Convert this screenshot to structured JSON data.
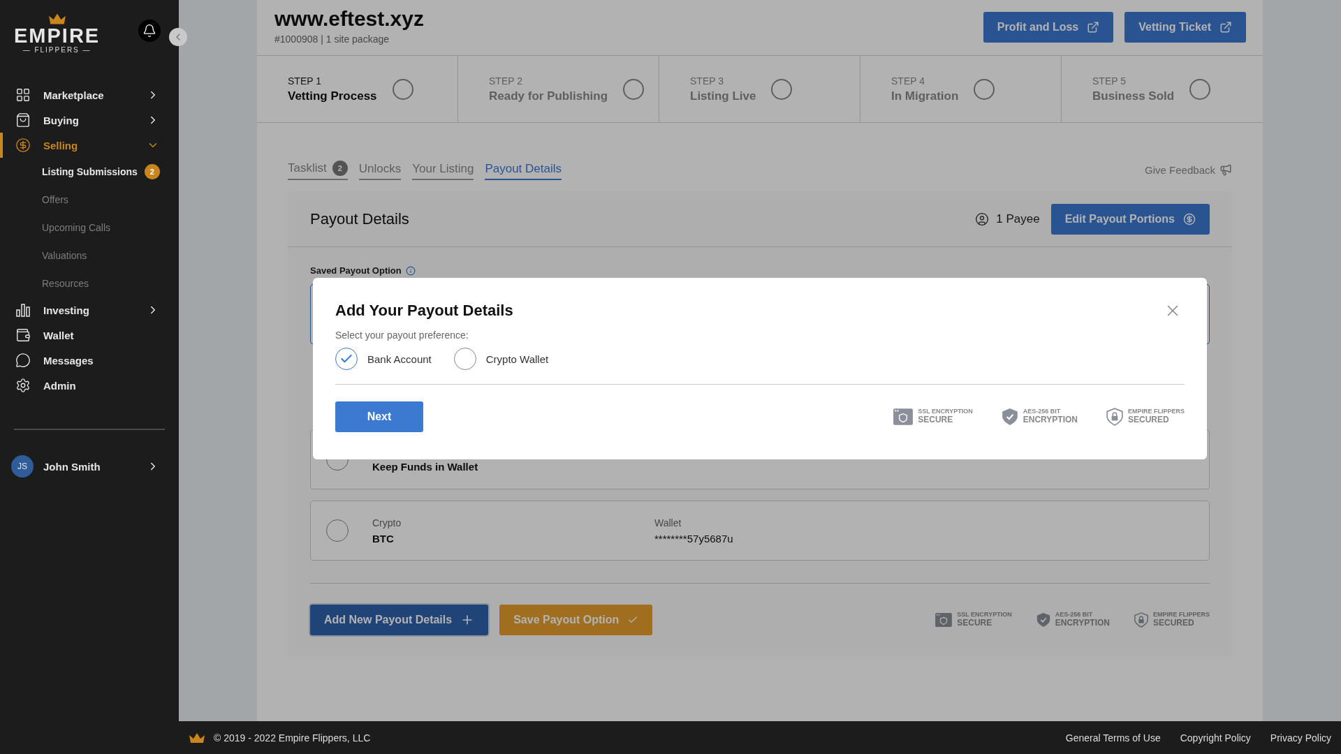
{
  "sidebar": {
    "logo": {
      "word": "EMPIRE",
      "sub": "— FLIPPERS —"
    },
    "items": [
      {
        "label": "Marketplace",
        "selected": false,
        "expandable": true,
        "expanded": false
      },
      {
        "label": "Buying",
        "selected": false,
        "expandable": true,
        "expanded": false
      },
      {
        "label": "Selling",
        "selected": true,
        "expandable": true,
        "expanded": true,
        "children": [
          {
            "label": "Listing Submissions",
            "selected": true,
            "badge": "2"
          },
          {
            "label": "Offers",
            "selected": false
          },
          {
            "label": "Upcoming Calls",
            "selected": false
          },
          {
            "label": "Valuations",
            "selected": false
          },
          {
            "label": "Resources",
            "selected": false
          }
        ]
      },
      {
        "label": "Investing",
        "selected": false,
        "expandable": true,
        "expanded": false
      },
      {
        "label": "Wallet",
        "selected": false,
        "expandable": false
      },
      {
        "label": "Messages",
        "selected": false,
        "expandable": false
      },
      {
        "label": "Admin",
        "selected": false,
        "expandable": false
      }
    ],
    "user": {
      "initials": "JS",
      "name": "John Smith"
    }
  },
  "header": {
    "title": "www.eftest.xyz",
    "subtitle": "#1000908 | 1 site package",
    "buttons": [
      "Profit and Loss",
      "Vetting Ticket"
    ]
  },
  "steps": [
    {
      "step": "STEP 1",
      "name": "Vetting Process",
      "selected": true
    },
    {
      "step": "STEP 2",
      "name": "Ready for Publishing",
      "selected": false
    },
    {
      "step": "STEP 3",
      "name": "Listing Live",
      "selected": false
    },
    {
      "step": "STEP 4",
      "name": "In Migration",
      "selected": false
    },
    {
      "step": "STEP 5",
      "name": "Business Sold",
      "selected": false
    }
  ],
  "tabs": [
    {
      "label": "Tasklist",
      "badge": "2",
      "selected": false
    },
    {
      "label": "Unlocks",
      "selected": false
    },
    {
      "label": "Your Listing",
      "selected": false
    },
    {
      "label": "Payout Details",
      "selected": true
    }
  ],
  "feedback": "Give Feedback",
  "card": {
    "title": "Payout Details",
    "payee": "1 Payee",
    "edit_button": "Edit Payout Portions",
    "saved_label": "Saved Payout Option",
    "options": [
      {
        "kind": "wallet",
        "value": "Keep Funds in Wallet",
        "selected": false
      },
      {
        "kind": "crypto",
        "label": "Crypto",
        "value": "BTC",
        "wallet_label": "Wallet",
        "wallet": "********57y5687u",
        "selected": false
      }
    ],
    "add_button": "Add New Payout Details",
    "save_button": "Save Payout Option"
  },
  "security": [
    {
      "kind": "ssl",
      "top": "SSL ENCRYPTION",
      "bottom": "SECURE"
    },
    {
      "kind": "aes",
      "top": "AES-256 BIT",
      "bottom": "ENCRYPTION"
    },
    {
      "kind": "ef",
      "top": "EMPIRE FLIPPERS",
      "bottom": "SECURED"
    }
  ],
  "modal": {
    "title": "Add Your Payout Details",
    "prompt": "Select your payout preference:",
    "choices": [
      {
        "label": "Bank Account",
        "selected": true
      },
      {
        "label": "Crypto Wallet",
        "selected": false
      }
    ],
    "button": "Next",
    "security": [
      {
        "kind": "ssl",
        "top": "SSL ENCRYPTION",
        "bottom": "SECURE"
      },
      {
        "kind": "aes",
        "top": "AES-256 BIT",
        "bottom": "ENCRYPTION"
      },
      {
        "kind": "ef",
        "top": "EMPIRE FLIPPERS",
        "bottom": "SECURED"
      }
    ]
  },
  "footer": {
    "copyright": "© 2019 - 2022 Empire Flippers, LLC",
    "links": [
      "General Terms of Use",
      "Copyright Policy",
      "Privacy Policy"
    ]
  }
}
